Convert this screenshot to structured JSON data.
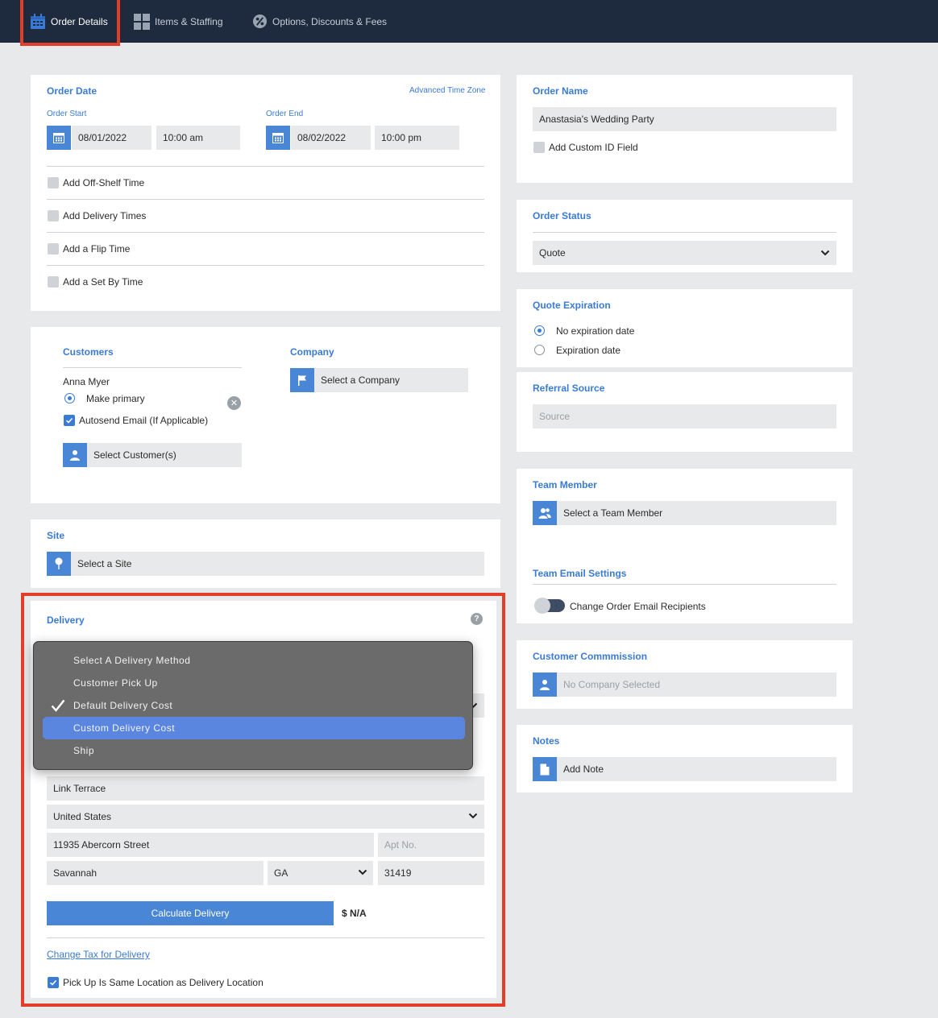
{
  "tabs": [
    {
      "label": "Order Details"
    },
    {
      "label": "Items & Staffing"
    },
    {
      "label": "Options, Discounts & Fees"
    }
  ],
  "order_date": {
    "title": "Order Date",
    "advanced_link": "Advanced Time Zone",
    "start_label": "Order Start",
    "start_date": "08/01/2022",
    "start_time": "10:00 am",
    "end_label": "Order End",
    "end_date": "08/02/2022",
    "end_time": "10:00 pm",
    "options": [
      "Add Off-Shelf Time",
      "Add Delivery Times",
      "Add a Flip Time",
      "Add a Set By Time"
    ]
  },
  "customers": {
    "title": "Customers",
    "name": "Anna Myer",
    "make_primary": "Make primary",
    "autosend": "Autosend Email (If Applicable)",
    "select_button": "Select Customer(s)"
  },
  "company": {
    "title": "Company",
    "select_button": "Select a Company"
  },
  "site": {
    "title": "Site",
    "select_button": "Select a Site"
  },
  "delivery": {
    "title": "Delivery",
    "help": "?",
    "menu": [
      "Select A Delivery Method",
      "Customer Pick Up",
      "Default Delivery Cost",
      "Custom Delivery Cost",
      "Ship"
    ],
    "selected_index": 2,
    "highlighted_index": 3,
    "location_name": "Link Terrace",
    "country": "United States",
    "street": "11935 Abercorn Street",
    "apt_placeholder": "Apt No.",
    "city": "Savannah",
    "state": "GA",
    "zip": "31419",
    "calc_button": "Calculate Delivery",
    "cost": "$ N/A",
    "tax_link": "Change Tax for Delivery",
    "pickup_same": "Pick Up Is Same Location as Delivery Location"
  },
  "order_name": {
    "title": "Order Name",
    "value": "Anastasia's Wedding Party",
    "custom_id": "Add Custom ID Field"
  },
  "order_status": {
    "title": "Order Status",
    "value": "Quote"
  },
  "quote_expiration": {
    "title": "Quote Expiration",
    "opt1": "No expiration date",
    "opt2": "Expiration date"
  },
  "referral": {
    "title": "Referral Source",
    "placeholder": "Source"
  },
  "team": {
    "title": "Team Member",
    "select_button": "Select a Team Member",
    "email_title": "Team Email Settings",
    "email_toggle": "Change Order Email Recipients"
  },
  "commission": {
    "title": "Customer Commmission",
    "placeholder": "No Company Selected"
  },
  "notes": {
    "title": "Notes",
    "add_button": "Add Note"
  },
  "colors": {
    "accent": "#3a7bd5",
    "topbar": "#1e2b3f",
    "highlight_outline": "#e23e2a",
    "menu_highlight": "#5b86e0"
  }
}
